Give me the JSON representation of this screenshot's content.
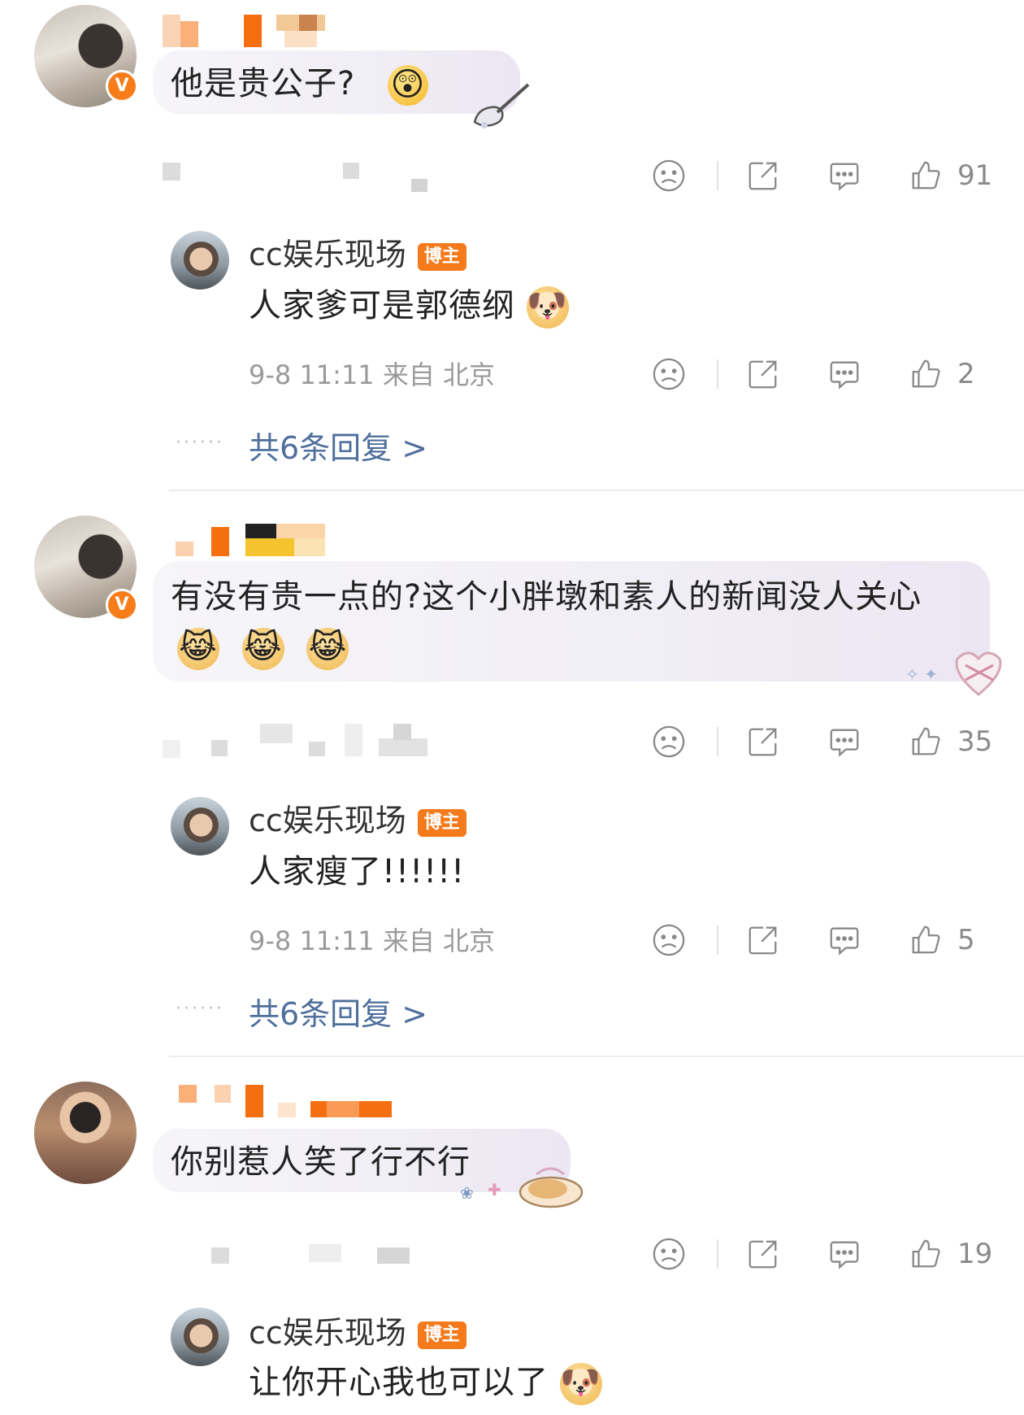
{
  "colors": {
    "accent_orange": "#f67d1a",
    "link_blue": "#4f6f9c",
    "meta_gray": "#9a9a9a"
  },
  "comments": [
    {
      "text": "他是贵公子?",
      "emoji": "😲",
      "likes": "91",
      "reply": {
        "name": "cc娱乐现场",
        "badge": "博主",
        "text": "人家爹可是郭德纲",
        "emoji": "🐶",
        "time": "9-8 11:11 来自 北京",
        "likes": "2"
      },
      "more": "共6条回复 >"
    },
    {
      "text": "有没有贵一点的?这个小胖墩和素人的新闻没人关心",
      "emoji": "😹",
      "likes": "35",
      "reply": {
        "name": "cc娱乐现场",
        "badge": "博主",
        "text": "人家瘦了!!!!!!",
        "time": "9-8 11:11 来自 北京",
        "likes": "5"
      },
      "more": "共6条回复 >"
    },
    {
      "text": "你别惹人笑了行不行",
      "likes": "19",
      "reply": {
        "name": "cc娱乐现场",
        "badge": "博主",
        "text": "让你开心我也可以了",
        "emoji": "🐶"
      }
    }
  ],
  "icons": {
    "dislike": "frown-face-icon",
    "share": "share-icon",
    "comment": "comment-bubble-icon",
    "like": "thumbs-up-icon",
    "verified": "verified-v-icon"
  },
  "verified_mark": "V"
}
